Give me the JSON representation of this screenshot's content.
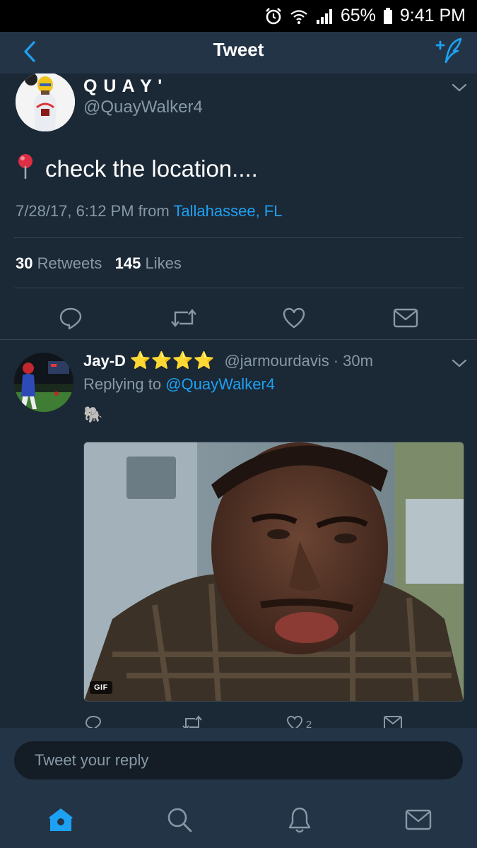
{
  "status_bar": {
    "battery": "65%",
    "time": "9:41 PM"
  },
  "nav": {
    "title": "Tweet"
  },
  "tweet": {
    "author_name": "Q U A Y '",
    "author_handle": "@QuayWalker4",
    "text": "check the location....",
    "timestamp": "7/28/17, 6:12 PM from",
    "location": "Tallahassee, FL",
    "retweet_count": "30",
    "retweet_label": "Retweets",
    "like_count": "145",
    "like_label": "Likes"
  },
  "reply": {
    "author_name": "Jay-D",
    "stars": "⭐⭐⭐⭐",
    "author_handle": "@jarmourdavis",
    "time": "· 30m",
    "replying_prefix": "Replying to",
    "replying_handle": "@QuayWalker4",
    "emoji": "🐘",
    "media_badge": "GIF",
    "like_count": "2"
  },
  "reply_box": {
    "placeholder": "Tweet your reply"
  },
  "icons": {
    "accent": "#1da1f2",
    "muted": "#8899a6",
    "names": [
      "back-icon",
      "compose-icon",
      "reply-icon",
      "retweet-icon",
      "like-icon",
      "message-icon",
      "home-icon",
      "search-icon",
      "notifications-icon",
      "messages-icon"
    ]
  }
}
